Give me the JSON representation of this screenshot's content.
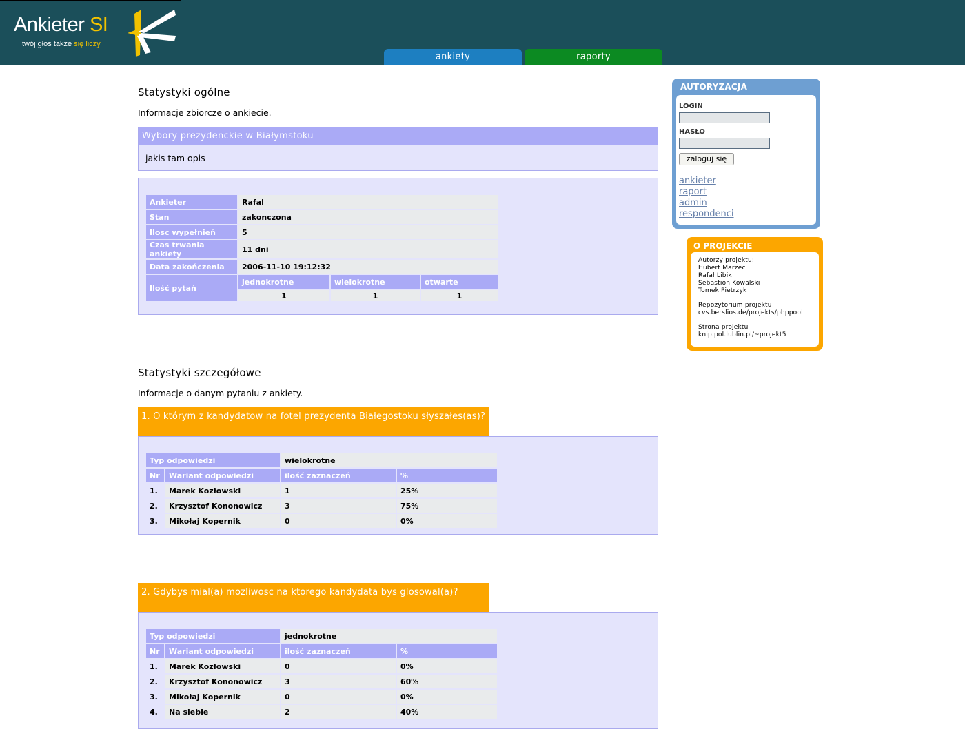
{
  "header": {
    "logo_title": "Ankieter",
    "logo_title_accent": "SI",
    "tagline_pre": "twój głos także ",
    "tagline_accent": "się liczy",
    "tabs": [
      {
        "label": "ankiety"
      },
      {
        "label": "raporty"
      }
    ]
  },
  "general": {
    "title": "Statystyki ogólne",
    "intro": "Informacje zbiorcze o ankiecie.",
    "survey_name": "Wybory prezydenckie w Białymstoku",
    "survey_desc": "jakis tam opis",
    "rows": [
      {
        "label": "Ankieter",
        "value": "Rafal"
      },
      {
        "label": "Stan",
        "value": "zakonczona"
      },
      {
        "label": "Ilosc wypełnień",
        "value": "5"
      },
      {
        "label": "Czas trwania ankiety",
        "value": "11 dni"
      },
      {
        "label": "Data zakończenia",
        "value": "2006-11-10 19:12:32"
      }
    ],
    "questions_label": "Ilość pytań",
    "question_types": [
      "jednokrotne",
      "wielokrotne",
      "otwarte"
    ],
    "question_counts": [
      "1",
      "1",
      "1"
    ]
  },
  "detailed": {
    "title": "Statystyki szczegółowe",
    "intro": "Informacje o danym pytaniu z ankiety.",
    "type_label": "Typ odpowiedzi",
    "col_nr": "Nr",
    "col_variant": "Wariant odpowiedzi",
    "col_count": "ilość zaznaczeń",
    "col_pct": "%",
    "questions": [
      {
        "title": "1. O którym z kandydatow na fotel prezydenta Białegostoku słyszałes(as)?",
        "type": "wielokrotne",
        "answers": [
          {
            "nr": "1.",
            "variant": "Marek Kozłowski",
            "count": "1",
            "pct": "25%"
          },
          {
            "nr": "2.",
            "variant": "Krzysztof Kononowicz",
            "count": "3",
            "pct": "75%"
          },
          {
            "nr": "3.",
            "variant": "Mikołaj Kopernik",
            "count": "0",
            "pct": "0%"
          }
        ]
      },
      {
        "title": "2. Gdybys mial(a) mozliwosc na ktorego kandydata bys glosowal(a)?",
        "type": "jednokrotne",
        "answers": [
          {
            "nr": "1.",
            "variant": "Marek Kozłowski",
            "count": "0",
            "pct": "0%"
          },
          {
            "nr": "2.",
            "variant": "Krzysztof Kononowicz",
            "count": "3",
            "pct": "60%"
          },
          {
            "nr": "3.",
            "variant": "Mikołaj Kopernik",
            "count": "0",
            "pct": "0%"
          },
          {
            "nr": "4.",
            "variant": "Na siebie",
            "count": "2",
            "pct": "40%"
          }
        ]
      }
    ]
  },
  "auth": {
    "title": "AUTORYZACJA",
    "login_label": "LOGIN",
    "password_label": "HASŁO",
    "login_value": "",
    "password_value": "",
    "submit_label": "zaloguj się",
    "links": [
      "ankieter",
      "raport",
      "admin",
      "respondenci"
    ]
  },
  "project": {
    "title": "O PROJEKCIE",
    "lines": [
      "Autorzy projektu:",
      "Hubert Marzec",
      "Rafał Libik",
      "Sebastion Kowalski",
      "Tomek Pietrzyk",
      "",
      "Repozytorium projektu",
      "cvs.berslios.de/projekts/phppool",
      "",
      "Strona projektu",
      "knip.pol.lublin.pl/~projekt5"
    ]
  },
  "colors": {
    "header_bg": "#1b4f5a",
    "tab_ankiety": "#1d7fc1",
    "tab_raporty": "#0c8a22",
    "lavender_header": "#aaaaf6",
    "lavender_bg": "#e4e4fc",
    "orange": "#fca600",
    "auth_blue": "#6e9fd2"
  }
}
